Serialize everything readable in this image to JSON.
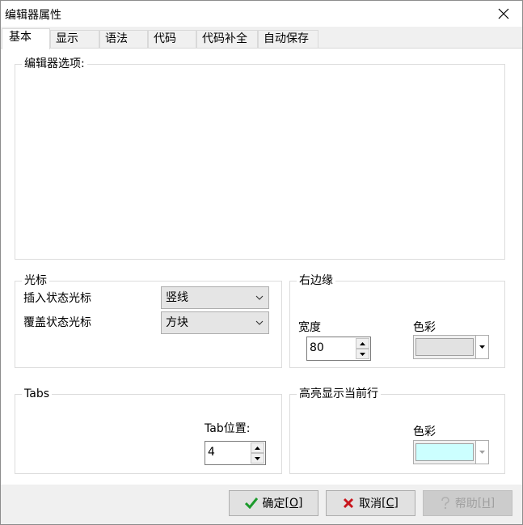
{
  "window": {
    "title": "编辑器属性"
  },
  "tabs": [
    {
      "label": "基本"
    },
    {
      "label": "显示"
    },
    {
      "label": "语法"
    },
    {
      "label": "代码"
    },
    {
      "label": "代码补全"
    },
    {
      "label": "自动保存"
    }
  ],
  "editor_options": {
    "label": "编辑器选项:"
  },
  "cursor": {
    "label": "光标",
    "insert_label": "插入状态光标",
    "insert_value": "竖线",
    "overwrite_label": "覆盖状态光标",
    "overwrite_value": "方块"
  },
  "right_margin": {
    "label": "右边缘",
    "width_label": "宽度",
    "width_value": "80",
    "color_label": "色彩",
    "color": "#e2e2e2"
  },
  "tabs_group": {
    "label": "Tabs",
    "tab_pos_label": "Tab位置:",
    "tab_pos_value": "4"
  },
  "highlight": {
    "label": "高亮显示当前行",
    "color_label": "色彩",
    "color": "#ccffff"
  },
  "buttons": {
    "ok": {
      "label": "确定",
      "accel": "[O]"
    },
    "cancel": {
      "label": "取消",
      "accel": "[C]"
    },
    "help": {
      "label": "帮助",
      "accel": "[H]"
    }
  }
}
